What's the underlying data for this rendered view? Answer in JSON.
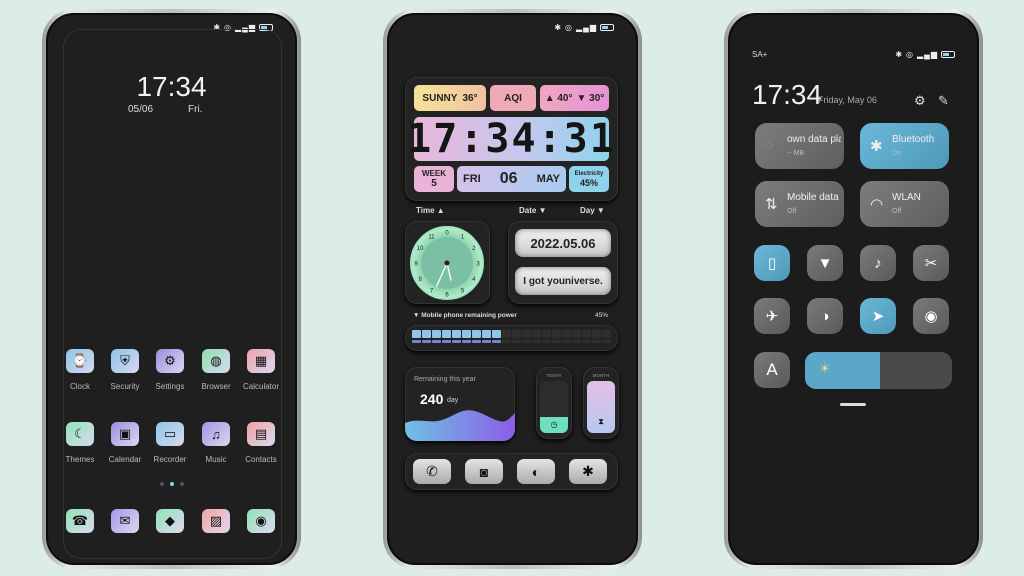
{
  "colors": {
    "background": "#dcece7",
    "accent_blue": "#5aa7c9",
    "screen": "#1f1f1f"
  },
  "phone1": {
    "status_icons": [
      "bluetooth-icon",
      "alarm-icon",
      "signal-icon",
      "battery-icon"
    ],
    "time": "17:34",
    "date": "05/06",
    "weekday": "Fri.",
    "apps": [
      {
        "label": "Clock",
        "icon": "watch-icon",
        "glyph": "⌚",
        "color": "#8cc6e6"
      },
      {
        "label": "Security",
        "icon": "shield-icon",
        "glyph": "⛨",
        "color": "#8fc3e8"
      },
      {
        "label": "Settings",
        "icon": "gear-icon",
        "glyph": "⚙",
        "color": "#9b8fe0"
      },
      {
        "label": "Browser",
        "icon": "planet-icon",
        "glyph": "◍",
        "color": "#8ee0b0"
      },
      {
        "label": "Calculator",
        "icon": "calculator-icon",
        "glyph": "▦",
        "color": "#efa3a8"
      },
      {
        "label": "Themes",
        "icon": "moon-icon",
        "glyph": "☾",
        "color": "#8fe6b8"
      },
      {
        "label": "Calendar",
        "icon": "calendar-icon",
        "glyph": "▣",
        "color": "#9c8fe2"
      },
      {
        "label": "Recorder",
        "icon": "radio-icon",
        "glyph": "▭",
        "color": "#8fc6e8"
      },
      {
        "label": "Music",
        "icon": "music-note-icon",
        "glyph": "♫",
        "color": "#a394e4"
      },
      {
        "label": "Contacts",
        "icon": "contacts-book-icon",
        "glyph": "▤",
        "color": "#f0a3a3"
      }
    ],
    "dock": [
      {
        "icon": "phone-icon",
        "glyph": "☎",
        "color": "#8fe3b6"
      },
      {
        "icon": "message-icon",
        "glyph": "✉",
        "color": "#a596e6"
      },
      {
        "icon": "tag-icon",
        "glyph": "◆",
        "color": "#90e2b5"
      },
      {
        "icon": "gallery-icon",
        "glyph": "▨",
        "color": "#f0a5a5"
      },
      {
        "icon": "camera-icon",
        "glyph": "◉",
        "color": "#8fe3b6"
      }
    ],
    "page_dots": 3,
    "active_page": 1
  },
  "phone2": {
    "weather": {
      "condition": "SUNNY",
      "temp": "36°",
      "aqi": "AQI",
      "high": "▲ 40°",
      "low": "▼ 30°"
    },
    "digital_time": "17:34:31",
    "week_label": "WEEK",
    "week": "5",
    "day": "FRI",
    "date": "06",
    "month": "MAY",
    "electricity_label": "Electricity",
    "electricity": "45%",
    "labels": {
      "time": "Time ▲",
      "date": "Date ▼",
      "day": "Day ▼"
    },
    "analog_clock": {
      "hour": 17,
      "minute": 34,
      "numerals": [
        "0",
        "1",
        "2",
        "3",
        "4",
        "5",
        "6",
        "7",
        "8",
        "9",
        "10",
        "11"
      ]
    },
    "full_date": "2022.05.06",
    "slogan": "I got youniverse.",
    "power": {
      "label": "▼ Mobile phone remaining power",
      "value_text": "45%",
      "percent": 45,
      "segments": 20
    },
    "year": {
      "label": "Remaining this year",
      "value": "240",
      "unit": "day"
    },
    "today_label": "TODAY",
    "month_label": "MONTH",
    "dock": [
      {
        "icon": "phone-icon",
        "glyph": "✆"
      },
      {
        "icon": "camera-icon",
        "glyph": "◙"
      },
      {
        "icon": "globe-icon",
        "glyph": "◐"
      },
      {
        "icon": "puzzle-icon",
        "glyph": "✱"
      }
    ]
  },
  "phone3": {
    "carrier": "SA+",
    "time": "17:34",
    "date": "Friday, May 06",
    "tiles": [
      {
        "title": "own data plan",
        "sub": "-- MB",
        "icon": "water-drop-icon",
        "glyph": "◌",
        "active": false
      },
      {
        "title": "Bluetooth",
        "sub": "On",
        "icon": "bluetooth-icon",
        "glyph": "✱",
        "active": true
      },
      {
        "title": "Mobile data",
        "sub": "Off",
        "icon": "data-arrows-icon",
        "glyph": "⇅",
        "active": false
      },
      {
        "title": "WLAN",
        "sub": "Off",
        "icon": "wifi-icon",
        "glyph": "◠",
        "active": false
      }
    ],
    "toggles": [
      {
        "icon": "vibrate-icon",
        "glyph": "▯",
        "active": true
      },
      {
        "icon": "flashlight-icon",
        "glyph": "▼",
        "active": false
      },
      {
        "icon": "bell-icon",
        "glyph": "♪",
        "active": false
      },
      {
        "icon": "screenshot-icon",
        "glyph": "✂",
        "active": false
      },
      {
        "icon": "airplane-icon",
        "glyph": "✈",
        "active": false
      },
      {
        "icon": "contrast-icon",
        "glyph": "◑",
        "active": false
      },
      {
        "icon": "location-arrow-icon",
        "glyph": "➤",
        "active": true
      },
      {
        "icon": "eye-icon",
        "glyph": "◉",
        "active": false
      }
    ],
    "font_button": "A",
    "brightness": 0.51
  }
}
